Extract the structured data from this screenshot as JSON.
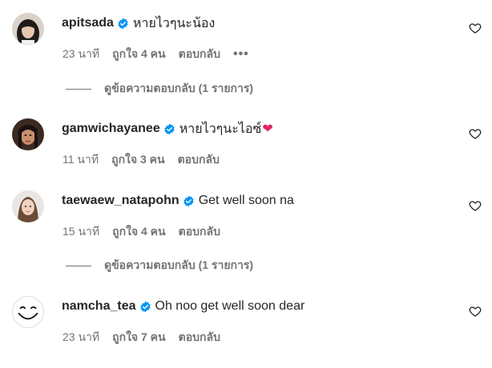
{
  "comments": [
    {
      "username": "apitsada",
      "text": "หายไวๆนะน้อง",
      "time": "23 นาที",
      "likes": "ถูกใจ 4 คน",
      "reply": "ตอบกลับ",
      "more": "•••",
      "avatar_icon": "profile-photo-dark-hair",
      "view_replies": "ดูข้อความตอบกลับ (1 รายการ)"
    },
    {
      "username": "gamwichayanee",
      "text": "หายไวๆนะไอซ์",
      "emoji": "❤",
      "time": "11 นาที",
      "likes": "ถูกใจ 3 คน",
      "reply": "ตอบกลับ",
      "avatar_icon": "profile-photo-woman-makeup"
    },
    {
      "username": "taewaew_natapohn",
      "text": "Get well soon na",
      "time": "15 นาที",
      "likes": "ถูกใจ 4 คน",
      "reply": "ตอบกลับ",
      "avatar_icon": "profile-photo-woman-light",
      "view_replies": "ดูข้อความตอบกลับ (1 รายการ)"
    },
    {
      "username": "namcha_tea",
      "text": "Oh noo get well soon dear",
      "time": "23 นาที",
      "likes": "ถูกใจ 7 คน",
      "reply": "ตอบกลับ",
      "avatar_icon": "smiley-face-drawing"
    }
  ],
  "colors": {
    "verified": "#0095f6",
    "heart_emoji": "#e0245e",
    "secondary_text": "#737373",
    "primary_text": "#262626"
  }
}
